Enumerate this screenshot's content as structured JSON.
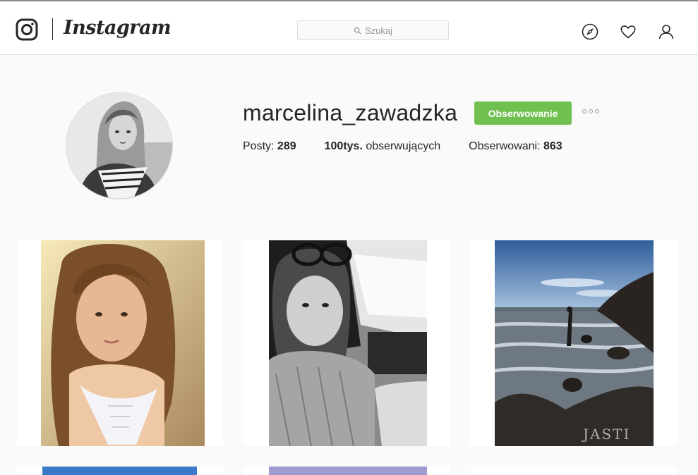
{
  "header": {
    "logo_text": "Instagram",
    "search_placeholder": "Szukaj",
    "icons": [
      "instagram-glyph-icon",
      "compass-icon",
      "heart-icon",
      "user-icon"
    ]
  },
  "profile": {
    "username": "marcelina_zawadzka",
    "follow_button": "Obserwowanie",
    "stats": {
      "posts_label": "Posty:",
      "posts_value": "289",
      "followers_value": "100tys.",
      "followers_label": "obserwujących",
      "following_label": "Obserwowani:",
      "following_value": "863"
    }
  },
  "watermark": "JASTI",
  "colors": {
    "follow_button": "#70c050",
    "background": "#fafafa",
    "border": "#dbdbdb"
  }
}
